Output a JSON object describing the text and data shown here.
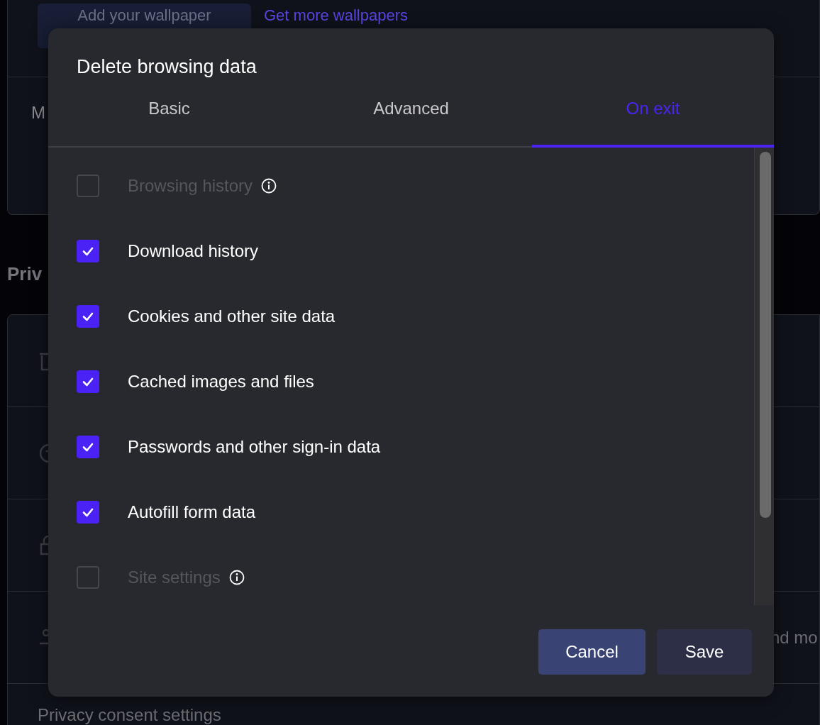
{
  "background": {
    "wallpaper_button": "Add your wallpaper",
    "wallpapers_link": "Get more wallpapers",
    "row_label": "M",
    "section_heading": "Priv",
    "row_text": "nd mo",
    "consent_link": "Privacy consent settings"
  },
  "dialog": {
    "title": "Delete browsing data",
    "tabs": [
      {
        "label": "Basic",
        "selected": false
      },
      {
        "label": "Advanced",
        "selected": false
      },
      {
        "label": "On exit",
        "selected": true
      }
    ],
    "items": [
      {
        "label": "Browsing history",
        "checked": false,
        "disabled": true,
        "info": true
      },
      {
        "label": "Download history",
        "checked": true,
        "disabled": false,
        "info": false
      },
      {
        "label": "Cookies and other site data",
        "checked": true,
        "disabled": false,
        "info": false
      },
      {
        "label": "Cached images and files",
        "checked": true,
        "disabled": false,
        "info": false
      },
      {
        "label": "Passwords and other sign-in data",
        "checked": true,
        "disabled": false,
        "info": false
      },
      {
        "label": "Autofill form data",
        "checked": true,
        "disabled": false,
        "info": false
      },
      {
        "label": "Site settings",
        "checked": false,
        "disabled": true,
        "info": true
      }
    ],
    "buttons": [
      {
        "label": "Cancel",
        "kind": "primary"
      },
      {
        "label": "Save",
        "kind": "secondary"
      }
    ]
  }
}
